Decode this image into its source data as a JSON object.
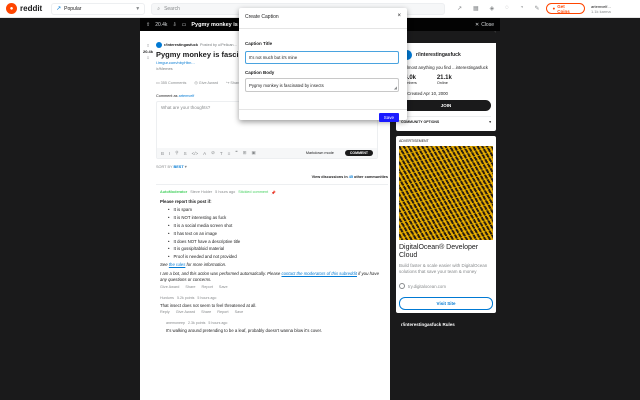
{
  "topbar": {
    "logo_text": "reddit",
    "feed": "Popular",
    "search_placeholder": "Search",
    "coins_label": "Get Coins",
    "username": "artemvelf...",
    "karma": "1.1k karma"
  },
  "post_header": {
    "votes": "20.4k",
    "title": "Pygmy monkey is fascinated...",
    "close_label": "Close"
  },
  "post": {
    "score": "20.4k",
    "subreddit": "r/interestingasfuck",
    "posted_by": "Posted by u/Pelican...",
    "title": "Pygmy monkey is fascinat...",
    "link": "i.imgur.com/nbyHbn...",
    "flair": "/r/Memes",
    "comments": "355 Comments",
    "give_award": "Give Award",
    "share": "Share"
  },
  "comment_box": {
    "label_prefix": "Comment as",
    "user": "artemvelf",
    "placeholder": "What are your thoughts?",
    "markdown": "Markdown mode",
    "submit": "COMMENT"
  },
  "sort": {
    "label": "SORT BY",
    "value": "BEST"
  },
  "view_discussions": {
    "prefix": "View discussions in",
    "count": "45",
    "suffix": "other communities"
  },
  "automod": {
    "author": "AutoModerator",
    "role": "Steve Holder",
    "time": "5 hours ago",
    "status": "Stickied comment",
    "intro": "Please report this post if:",
    "items": [
      "It is spam",
      "It is NOT interesting as fuck",
      "It is a social media screen shot",
      "It has text on an image",
      "It does NOT have a descriptive title",
      "It is gossip/tabloid material",
      "Proof is needed and not provided"
    ],
    "see_prefix": "See",
    "rules_link": "the rules",
    "see_suffix": "for more information.",
    "bot_note": "I am a bot, and this action was performed automatically. Please",
    "contact_link": "contact the moderators of this subreddit",
    "bot_note_end": "if you have any questions or concerns.",
    "actions": [
      "Give Award",
      "Share",
      "Report",
      "Save"
    ]
  },
  "reply1": {
    "author": "Hurdurrs",
    "points": "5.2k points",
    "time": "5 hours ago",
    "text": "That insect does not seem to feel threatened at all.",
    "actions": [
      "Reply",
      "Give Award",
      "Share",
      "Report",
      "Save"
    ]
  },
  "reply2": {
    "author": "anemoneep",
    "points": "2.3k points",
    "time": "5 hours ago",
    "text": "It's walking around pretending to be a leaf, probably doesn't wanna blow it's cover."
  },
  "sidebar": {
    "sub_name": "r/interestingasfuck",
    "description": "...almost anything you find ...interestingasfuck",
    "members": "24.0k",
    "members_label": "Members",
    "online": "21.1k",
    "online_label": "Online",
    "created": "Created Apr 10, 2000",
    "join": "JOIN",
    "options": "COMMUNITY OPTIONS",
    "rules_title": "r/interestingasfuck Rules"
  },
  "ad": {
    "label": "ADVERTISEMENT",
    "title": "DigitalOcean® Developer Cloud",
    "text": "Build faster & scale easier with DigitalOcean solutions that save your team & money",
    "url": "try.digitalocean.com",
    "button": "Visit Site"
  },
  "modal": {
    "title": "Create Caption",
    "caption_title_label": "Caption Title",
    "caption_title_value": "It's not much but it's mine",
    "caption_body_label": "Caption Body",
    "caption_body_value": "Pygmy monkey is fascinated by insects",
    "save": "Save"
  }
}
